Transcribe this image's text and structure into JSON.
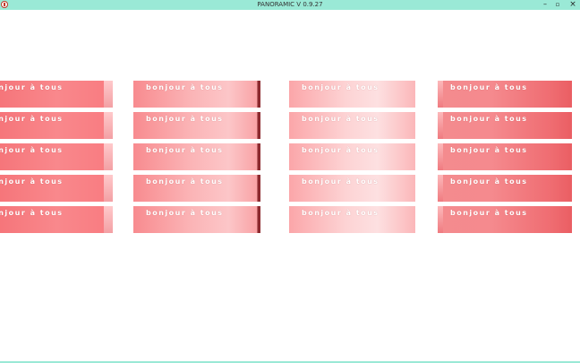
{
  "window": {
    "title": "PANORAMIC V 0.9.27",
    "minimize_glyph": "–",
    "maximize_glyph": "▫",
    "close_glyph": "×"
  },
  "colors": {
    "titlebar": "#9ae9d6",
    "tile_text": "#ffffff"
  },
  "icons": {
    "app": "panoramic-app-icon"
  },
  "grid": {
    "rows": 5,
    "columns": 4,
    "tile_label": "bonjour à tous",
    "tiles": [
      [
        "bonjour à tous",
        "bonjour à tous",
        "bonjour à tous",
        "bonjour à tous"
      ],
      [
        "bonjour à tous",
        "bonjour à tous",
        "bonjour à tous",
        "bonjour à tous"
      ],
      [
        "bonjour à tous",
        "bonjour à tous",
        "bonjour à tous",
        "bonjour à tous"
      ],
      [
        "bonjour à tous",
        "bonjour à tous",
        "bonjour à tous",
        "bonjour à tous"
      ],
      [
        "bonjour à tous",
        "bonjour à tous",
        "bonjour à tous",
        "bonjour à tous"
      ]
    ]
  }
}
